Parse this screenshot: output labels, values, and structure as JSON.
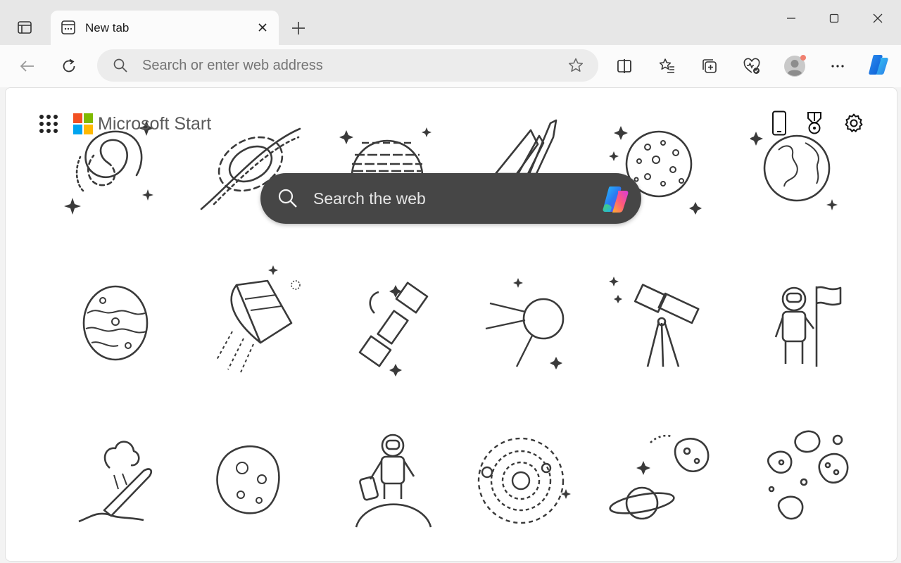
{
  "tab": {
    "title": "New tab"
  },
  "address_bar": {
    "placeholder": "Search or enter web address"
  },
  "ntp": {
    "brand": "Microsoft Start",
    "search_placeholder": "Search the web"
  },
  "icons": {
    "tab_actions": "tab-actions-icon",
    "tab_page": "new-tab-page-icon",
    "close_tab": "close-icon",
    "new_tab": "plus-icon",
    "minimize": "minimize-icon",
    "maximize": "maximize-icon",
    "close_window": "close-window-icon",
    "back": "back-arrow-icon",
    "refresh": "refresh-icon",
    "search": "search-icon",
    "favorite": "star-icon",
    "split": "split-screen-icon",
    "favorites": "favorites-icon",
    "collections": "collections-icon",
    "health": "browser-essentials-icon",
    "profile": "profile-avatar-icon",
    "more": "more-options-icon",
    "copilot": "copilot-icon",
    "apps": "app-launcher-icon",
    "phone": "phone-icon",
    "rewards": "rewards-medal-icon",
    "settings": "settings-gear-icon"
  },
  "colors": {
    "ntp_search_bg": "#464646",
    "ms_red": "#f25022",
    "ms_green": "#7fba00",
    "ms_blue": "#00a4ef",
    "ms_yellow": "#ffb900",
    "profile_badge": "#f08070"
  },
  "wallpaper": [
    "spiral-galaxy",
    "black-hole",
    "gas-giant-planet",
    "space-shuttle",
    "cratered-moon",
    "earth-globe",
    "swirl-planet",
    "space-capsule",
    "satellite",
    "sputnik",
    "telescope",
    "astronaut-with-flag",
    "rocket-crash",
    "asteroid",
    "astronaut-on-planet",
    "solar-system",
    "ringed-planet",
    "asteroid-field"
  ]
}
